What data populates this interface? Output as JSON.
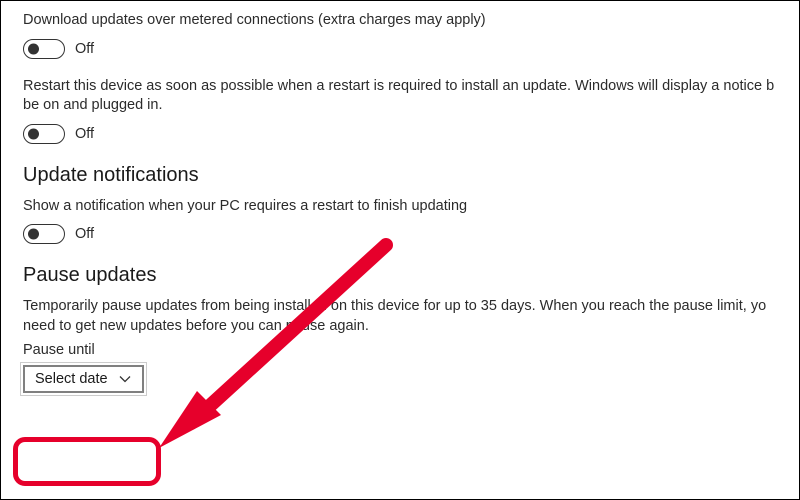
{
  "settings": {
    "metered": {
      "description": "Download updates over metered connections (extra charges may apply)",
      "state_label": "Off"
    },
    "restart_asap": {
      "description": "Restart this device as soon as possible when a restart is required to install an update. Windows will display a notice b be on and plugged in.",
      "state_label": "Off"
    }
  },
  "notifications": {
    "title": "Update notifications",
    "show_notification": {
      "description": "Show a notification when your PC requires a restart to finish updating",
      "state_label": "Off"
    }
  },
  "pause": {
    "title": "Pause updates",
    "description": "Temporarily pause updates from being installed on this device for up to 35 days. When you reach the pause limit, yo need to get new updates before you can pause again.",
    "field_label": "Pause until",
    "select_label": "Select date"
  },
  "annotation": {
    "color": "#e6002b"
  }
}
